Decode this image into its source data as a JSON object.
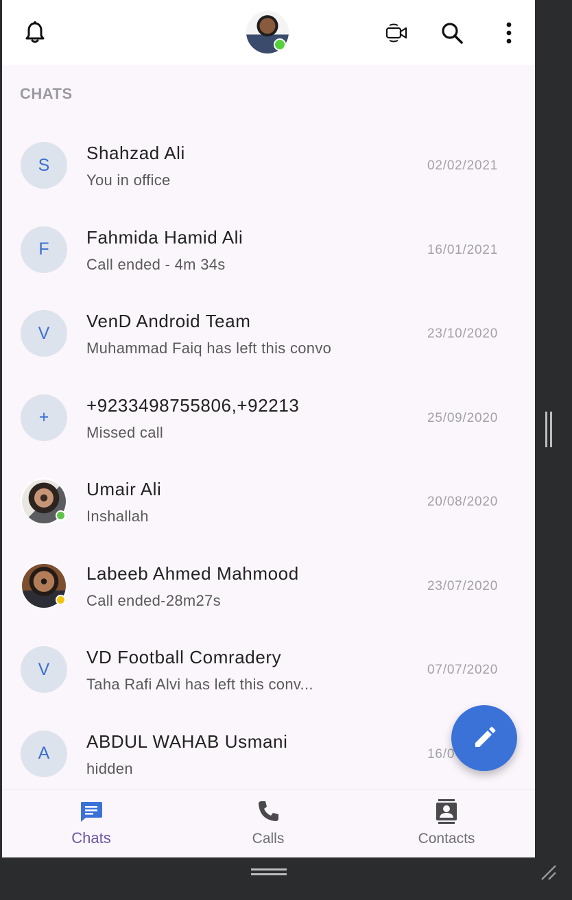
{
  "header": {
    "icons": [
      "bell-icon",
      "video-call-icon",
      "search-icon",
      "more-vert-icon"
    ],
    "profile_status_color": "#55d13b"
  },
  "section": {
    "title": "CHATS"
  },
  "chats": [
    {
      "name": "Shahzad Ali",
      "preview": "You in office",
      "date": "02/02/2021",
      "initial": "S"
    },
    {
      "name": "Fahmida Hamid Ali",
      "preview": "Call ended - 4m 34s",
      "date": "16/01/2021",
      "initial": "F"
    },
    {
      "name": "VenD Android Team",
      "preview": "Muhammad Faiq has left this convo",
      "date": "23/10/2020",
      "initial": "V"
    },
    {
      "name": "+9233498755806,+92213",
      "preview": "Missed call",
      "date": "25/09/2020",
      "initial": "+"
    },
    {
      "name": "Umair Ali",
      "preview": "Inshallah",
      "date": "20/08/2020",
      "status": "online"
    },
    {
      "name": "Labeeb Ahmed Mahmood",
      "preview": "Call ended-28m27s",
      "date": "23/07/2020",
      "status": "away"
    },
    {
      "name": "VD Football Comradery",
      "preview": "Taha Rafi Alvi has left this conv...",
      "date": "07/07/2020",
      "initial": "V"
    },
    {
      "name": "ABDUL WAHAB Usmani",
      "preview": "hidden",
      "date": "16/0",
      "initial": "A"
    }
  ],
  "fab": {
    "icon": "edit-pencil-icon",
    "color": "#3b72d8"
  },
  "bottom_nav": {
    "items": [
      {
        "label": "Chats",
        "icon": "chat-icon",
        "active": true
      },
      {
        "label": "Calls",
        "icon": "phone-icon",
        "active": false
      },
      {
        "label": "Contacts",
        "icon": "contacts-icon",
        "active": false
      }
    ]
  },
  "colors": {
    "accent": "#3b72d8",
    "nav_active": "#6b55a3",
    "background": "#fbf6fc"
  }
}
